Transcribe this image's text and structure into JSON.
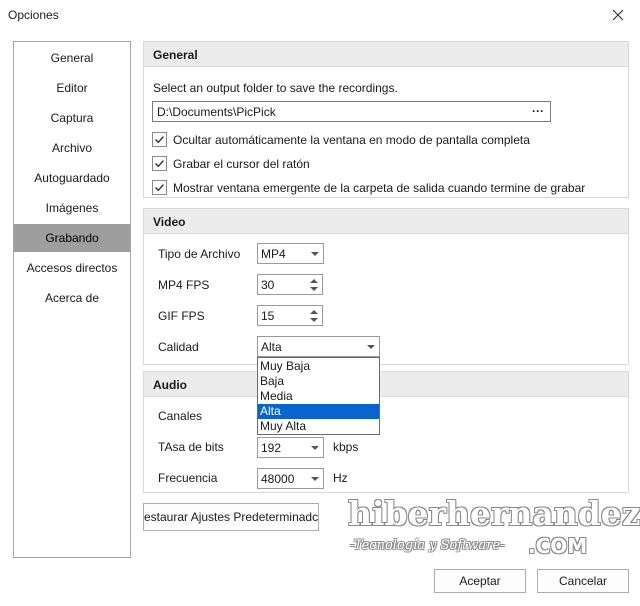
{
  "window": {
    "title": "Opciones"
  },
  "nav": {
    "items": [
      {
        "label": "General"
      },
      {
        "label": "Editor"
      },
      {
        "label": "Captura"
      },
      {
        "label": "Archivo"
      },
      {
        "label": "Autoguardado"
      },
      {
        "label": "Imágenes"
      },
      {
        "label": "Grabando"
      },
      {
        "label": "Accesos directos"
      },
      {
        "label": "Acerca de"
      }
    ],
    "selected": "Grabando"
  },
  "general": {
    "header": "General",
    "instruction": "Select an output folder to save the recordings.",
    "folder_value": "D:\\Documents\\PicPick",
    "browse_label": "···",
    "checkboxes": [
      {
        "label": "Ocultar automáticamente la ventana en modo de pantalla completa",
        "checked": true
      },
      {
        "label": "Grabar el cursor del ratón",
        "checked": true
      },
      {
        "label": "Mostrar ventana emergente de la carpeta de salida cuando termine de grabar",
        "checked": true
      }
    ]
  },
  "video": {
    "header": "Video",
    "file_type_label": "Tipo de Archivo",
    "file_type_value": "MP4",
    "mp4_fps_label": "MP4 FPS",
    "mp4_fps_value": "30",
    "gif_fps_label": "GIF FPS",
    "gif_fps_value": "15",
    "quality_label": "Calidad",
    "quality_value": "Alta",
    "quality_options": [
      "Muy Baja",
      "Baja",
      "Media",
      "Alta",
      "Muy Alta"
    ],
    "quality_selected": "Alta"
  },
  "audio": {
    "header": "Audio",
    "channels_label": "Canales",
    "bitrate_label": "TAsa de bits",
    "bitrate_value": "192",
    "bitrate_unit": "kbps",
    "frequency_label": "Frecuencia",
    "frequency_value": "48000",
    "frequency_unit": "Hz"
  },
  "buttons": {
    "restore": "estaurar Ajustes Predeterminadc",
    "ok": "Aceptar",
    "cancel": "Cancelar"
  },
  "watermark": {
    "main": "hiberhernandez",
    "sub": "-Tecnología y Software-",
    "com": ".COM"
  },
  "colors": {
    "nav_selected_bg": "#9e9e9e",
    "section_header_bg": "#ececec",
    "list_highlight": "#0a64d0"
  }
}
